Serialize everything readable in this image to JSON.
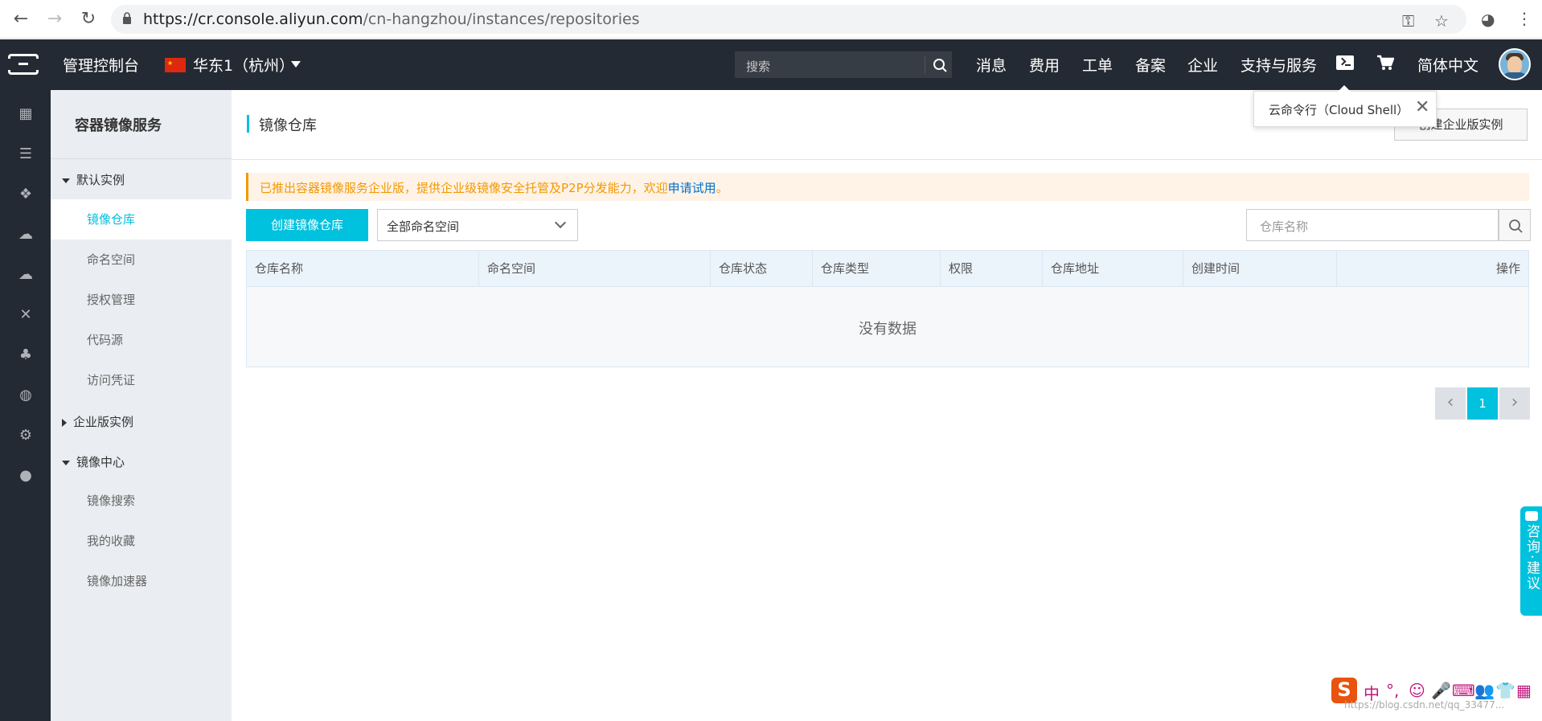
{
  "browser": {
    "url_host": "https://cr.console.aliyun.com",
    "url_path": "/cn-hangzhou/instances/repositories"
  },
  "topnav": {
    "console_title": "管理控制台",
    "region": "华东1（杭州）",
    "search_placeholder": "搜索",
    "links": [
      "消息",
      "费用",
      "工单",
      "备案",
      "企业",
      "支持与服务"
    ],
    "language": "简体中文"
  },
  "tooltip": {
    "text": "云命令行（Cloud Shell）",
    "close": "✕"
  },
  "sidebar": {
    "service_title": "容器镜像服务",
    "groups": [
      {
        "label": "默认实例",
        "expanded": true,
        "items": [
          "镜像仓库",
          "命名空间",
          "授权管理",
          "代码源",
          "访问凭证"
        ]
      },
      {
        "label": "企业版实例",
        "expanded": false,
        "items": []
      },
      {
        "label": "镜像中心",
        "expanded": true,
        "items": [
          "镜像搜索",
          "我的收藏",
          "镜像加速器"
        ]
      }
    ],
    "active_item": "镜像仓库"
  },
  "main": {
    "page_title": "镜像仓库",
    "create_enterprise_button": "创建企业版实例",
    "notice_text": "已推出容器镜像服务企业版，提供企业级镜像安全托管及P2P分发能力，欢迎",
    "notice_link": "申请试用",
    "notice_end": "。",
    "create_repo_button": "创建镜像仓库",
    "namespace_select": "全部命名空间",
    "repo_search_placeholder": "仓库名称",
    "table": {
      "columns": [
        "仓库名称",
        "命名空间",
        "仓库状态",
        "仓库类型",
        "权限",
        "仓库地址",
        "创建时间",
        "操作"
      ],
      "rows": [],
      "empty_text": "没有数据"
    },
    "pagination": {
      "current_page": "1",
      "prev": "‹",
      "next": "›"
    }
  },
  "floating": {
    "consult": "咨询·建议",
    "ime_logo": "S",
    "ime_glyphs": [
      "中",
      "°,",
      "☺",
      "🎤",
      "⌨",
      "👥",
      "👕",
      "▦"
    ],
    "watermark": "https://blog.csdn.net/qq_33477..."
  },
  "colors": {
    "accent": "#00c1de",
    "topnav_bg": "#242a33",
    "notice_text": "#f39800",
    "link": "#0070cc"
  }
}
